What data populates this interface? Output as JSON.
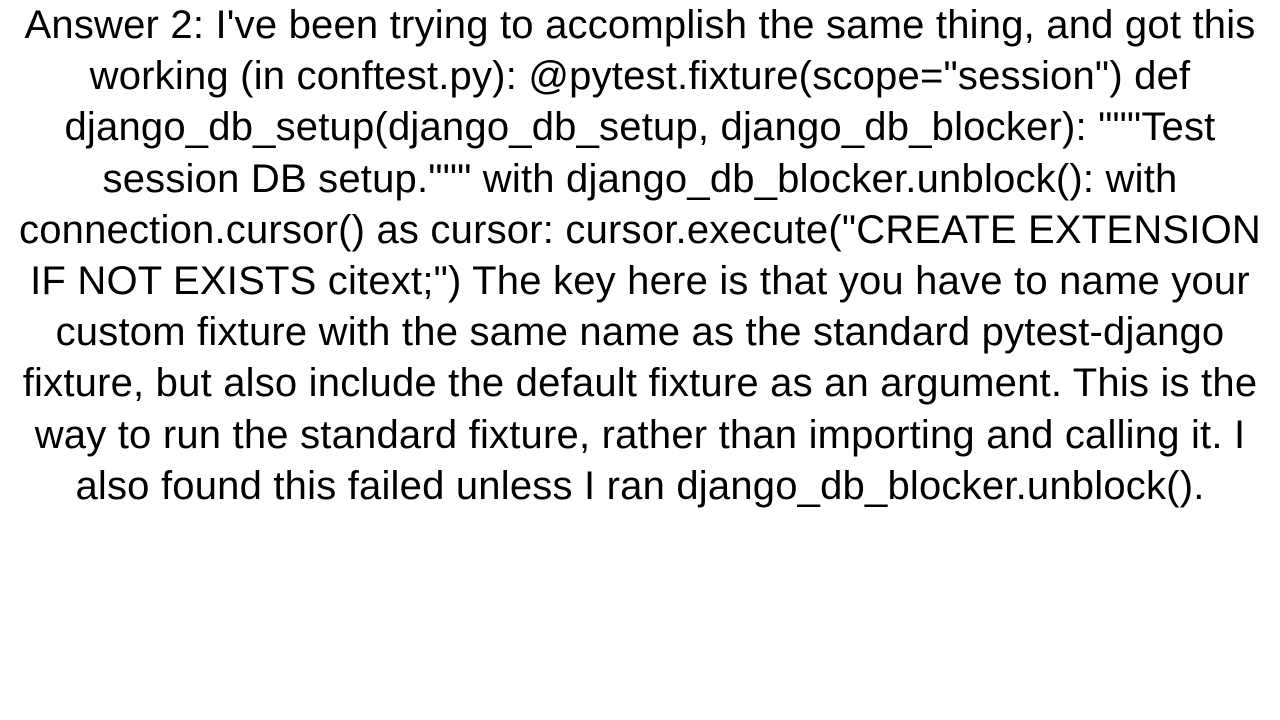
{
  "answer": {
    "text": "Answer 2: I've been trying to accomplish the same thing, and got this working (in conftest.py): @pytest.fixture(scope=\"session\") def django_db_setup(django_db_setup, django_db_blocker):     \"\"\"Test session DB setup.\"\"\"      with django_db_blocker.unblock():         with connection.cursor() as cursor:             cursor.execute(\"CREATE EXTENSION IF NOT EXISTS citext;\") The key here is that you have to name your custom fixture with the same name as the standard pytest-django fixture, but also include the default fixture as an argument. This is the way to run the standard fixture, rather than importing and calling it. I also found this failed unless I ran django_db_blocker.unblock()."
  }
}
